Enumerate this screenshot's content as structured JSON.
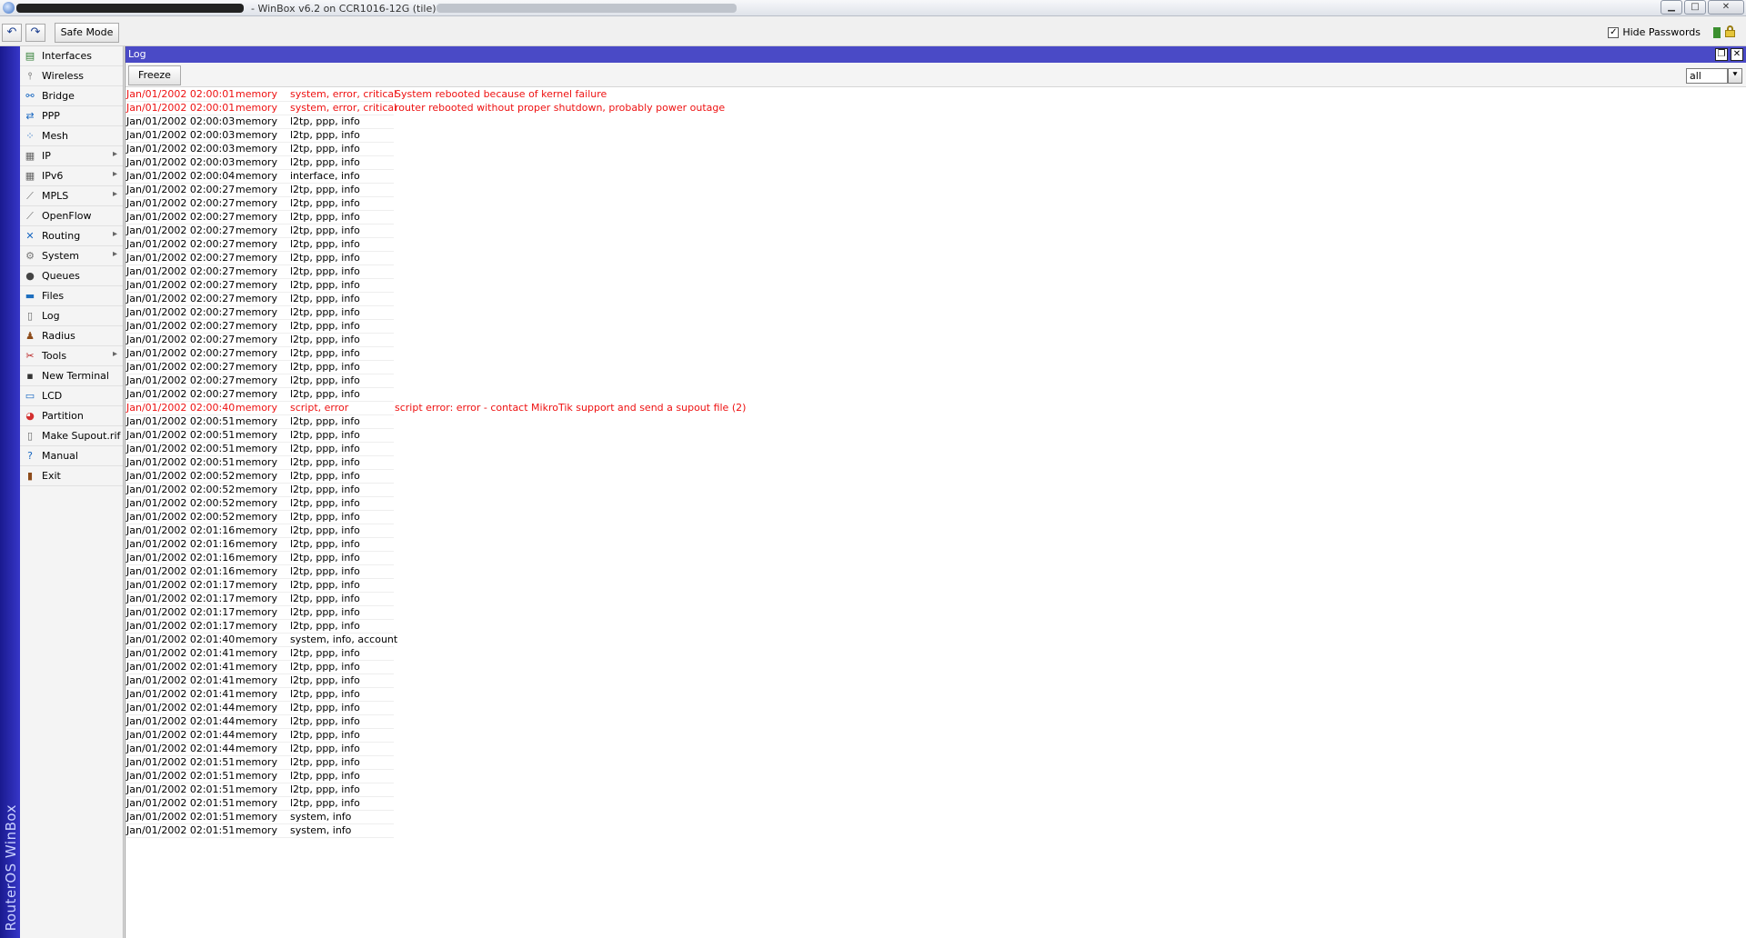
{
  "titlebar": {
    "title": " - WinBox v6.2 on CCR1016-12G (tile)"
  },
  "toolbar": {
    "undo_icon": "undo-icon",
    "redo_icon": "redo-icon",
    "safe_mode_label": "Safe Mode",
    "hide_passwords_label": "Hide Passwords",
    "hide_passwords_checked": "✓"
  },
  "brand": {
    "text": "RouterOS WinBox"
  },
  "sidebar": {
    "items": [
      {
        "label": "Interfaces",
        "icon": "interfaces-icon",
        "glyph": "▤",
        "color": "#2e7d32",
        "submenu": false
      },
      {
        "label": "Wireless",
        "icon": "wireless-icon",
        "glyph": "⫯",
        "color": "#555555",
        "submenu": false
      },
      {
        "label": "Bridge",
        "icon": "bridge-icon",
        "glyph": "⚯",
        "color": "#1565c0",
        "submenu": false
      },
      {
        "label": "PPP",
        "icon": "ppp-icon",
        "glyph": "⇄",
        "color": "#1565c0",
        "submenu": false
      },
      {
        "label": "Mesh",
        "icon": "mesh-icon",
        "glyph": "⁘",
        "color": "#1565c0",
        "submenu": false
      },
      {
        "label": "IP",
        "icon": "ip-icon",
        "glyph": "▦",
        "color": "#666666",
        "submenu": true
      },
      {
        "label": "IPv6",
        "icon": "ipv6-icon",
        "glyph": "▦",
        "color": "#666666",
        "submenu": true
      },
      {
        "label": "MPLS",
        "icon": "mpls-icon",
        "glyph": "⟋",
        "color": "#666666",
        "submenu": true
      },
      {
        "label": "OpenFlow",
        "icon": "openflow-icon",
        "glyph": "⟋",
        "color": "#666666",
        "submenu": false
      },
      {
        "label": "Routing",
        "icon": "routing-icon",
        "glyph": "✕",
        "color": "#1565c0",
        "submenu": true
      },
      {
        "label": "System",
        "icon": "system-icon",
        "glyph": "⚙",
        "color": "#777777",
        "submenu": true
      },
      {
        "label": "Queues",
        "icon": "queues-icon",
        "glyph": "●",
        "color": "#444444",
        "submenu": false
      },
      {
        "label": "Files",
        "icon": "files-icon",
        "glyph": "▬",
        "color": "#1e6fbf",
        "submenu": false
      },
      {
        "label": "Log",
        "icon": "log-icon",
        "glyph": "▯",
        "color": "#666666",
        "submenu": false
      },
      {
        "label": "Radius",
        "icon": "radius-icon",
        "glyph": "♟",
        "color": "#8d4b1a",
        "submenu": false
      },
      {
        "label": "Tools",
        "icon": "tools-icon",
        "glyph": "✂",
        "color": "#b71c1c",
        "submenu": true
      },
      {
        "label": "New Terminal",
        "icon": "terminal-icon",
        "glyph": "▪",
        "color": "#333333",
        "submenu": false
      },
      {
        "label": "LCD",
        "icon": "lcd-icon",
        "glyph": "▭",
        "color": "#1565c0",
        "submenu": false
      },
      {
        "label": "Partition",
        "icon": "partition-icon",
        "glyph": "◕",
        "color": "#d32f2f",
        "submenu": false
      },
      {
        "label": "Make Supout.rif",
        "icon": "supout-icon",
        "glyph": "▯",
        "color": "#666666",
        "submenu": false
      },
      {
        "label": "Manual",
        "icon": "manual-icon",
        "glyph": "?",
        "color": "#1565c0",
        "submenu": false
      },
      {
        "label": "Exit",
        "icon": "exit-icon",
        "glyph": "▮",
        "color": "#8d4b1a",
        "submenu": false
      }
    ]
  },
  "logwin": {
    "title": "Log",
    "restore_icon": "restore-icon",
    "close_icon": "close-icon",
    "freeze_label": "Freeze",
    "filter_value": "all",
    "filter_icon": "dropdown-icon"
  },
  "colors": {
    "error_text": "#ee1111",
    "window_title": "#4a4ac6"
  },
  "log": [
    {
      "time": "Jan/01/2002 02:00:01",
      "buffer": "memory",
      "topics": "system, error, critical",
      "message": "System rebooted because of kernel failure",
      "red": true
    },
    {
      "time": "Jan/01/2002 02:00:01",
      "buffer": "memory",
      "topics": "system, error, critical",
      "message": "router rebooted without proper shutdown, probably power outage",
      "red": true
    },
    {
      "time": "Jan/01/2002 02:00:03",
      "buffer": "memory",
      "topics": "l2tp, ppp, info",
      "message": "",
      "red": false
    },
    {
      "time": "Jan/01/2002 02:00:03",
      "buffer": "memory",
      "topics": "l2tp, ppp, info",
      "message": "",
      "red": false
    },
    {
      "time": "Jan/01/2002 02:00:03",
      "buffer": "memory",
      "topics": "l2tp, ppp, info",
      "message": "",
      "red": false
    },
    {
      "time": "Jan/01/2002 02:00:03",
      "buffer": "memory",
      "topics": "l2tp, ppp, info",
      "message": "",
      "red": false
    },
    {
      "time": "Jan/01/2002 02:00:04",
      "buffer": "memory",
      "topics": "interface, info",
      "message": "",
      "red": false
    },
    {
      "time": "Jan/01/2002 02:00:27",
      "buffer": "memory",
      "topics": "l2tp, ppp, info",
      "message": "",
      "red": false
    },
    {
      "time": "Jan/01/2002 02:00:27",
      "buffer": "memory",
      "topics": "l2tp, ppp, info",
      "message": "",
      "red": false
    },
    {
      "time": "Jan/01/2002 02:00:27",
      "buffer": "memory",
      "topics": "l2tp, ppp, info",
      "message": "",
      "red": false
    },
    {
      "time": "Jan/01/2002 02:00:27",
      "buffer": "memory",
      "topics": "l2tp, ppp, info",
      "message": "",
      "red": false
    },
    {
      "time": "Jan/01/2002 02:00:27",
      "buffer": "memory",
      "topics": "l2tp, ppp, info",
      "message": "",
      "red": false
    },
    {
      "time": "Jan/01/2002 02:00:27",
      "buffer": "memory",
      "topics": "l2tp, ppp, info",
      "message": "",
      "red": false
    },
    {
      "time": "Jan/01/2002 02:00:27",
      "buffer": "memory",
      "topics": "l2tp, ppp, info",
      "message": "",
      "red": false
    },
    {
      "time": "Jan/01/2002 02:00:27",
      "buffer": "memory",
      "topics": "l2tp, ppp, info",
      "message": "",
      "red": false
    },
    {
      "time": "Jan/01/2002 02:00:27",
      "buffer": "memory",
      "topics": "l2tp, ppp, info",
      "message": "",
      "red": false
    },
    {
      "time": "Jan/01/2002 02:00:27",
      "buffer": "memory",
      "topics": "l2tp, ppp, info",
      "message": "",
      "red": false
    },
    {
      "time": "Jan/01/2002 02:00:27",
      "buffer": "memory",
      "topics": "l2tp, ppp, info",
      "message": "",
      "red": false
    },
    {
      "time": "Jan/01/2002 02:00:27",
      "buffer": "memory",
      "topics": "l2tp, ppp, info",
      "message": "",
      "red": false
    },
    {
      "time": "Jan/01/2002 02:00:27",
      "buffer": "memory",
      "topics": "l2tp, ppp, info",
      "message": "",
      "red": false
    },
    {
      "time": "Jan/01/2002 02:00:27",
      "buffer": "memory",
      "topics": "l2tp, ppp, info",
      "message": "",
      "red": false
    },
    {
      "time": "Jan/01/2002 02:00:27",
      "buffer": "memory",
      "topics": "l2tp, ppp, info",
      "message": "",
      "red": false
    },
    {
      "time": "Jan/01/2002 02:00:27",
      "buffer": "memory",
      "topics": "l2tp, ppp, info",
      "message": "",
      "red": false
    },
    {
      "time": "Jan/01/2002 02:00:40",
      "buffer": "memory",
      "topics": "script, error",
      "message": "script error: error - contact MikroTik support and send a supout file (2)",
      "red": true
    },
    {
      "time": "Jan/01/2002 02:00:51",
      "buffer": "memory",
      "topics": "l2tp, ppp, info",
      "message": "",
      "red": false
    },
    {
      "time": "Jan/01/2002 02:00:51",
      "buffer": "memory",
      "topics": "l2tp, ppp, info",
      "message": "",
      "red": false
    },
    {
      "time": "Jan/01/2002 02:00:51",
      "buffer": "memory",
      "topics": "l2tp, ppp, info",
      "message": "",
      "red": false
    },
    {
      "time": "Jan/01/2002 02:00:51",
      "buffer": "memory",
      "topics": "l2tp, ppp, info",
      "message": "",
      "red": false
    },
    {
      "time": "Jan/01/2002 02:00:52",
      "buffer": "memory",
      "topics": "l2tp, ppp, info",
      "message": "",
      "red": false
    },
    {
      "time": "Jan/01/2002 02:00:52",
      "buffer": "memory",
      "topics": "l2tp, ppp, info",
      "message": "",
      "red": false
    },
    {
      "time": "Jan/01/2002 02:00:52",
      "buffer": "memory",
      "topics": "l2tp, ppp, info",
      "message": "",
      "red": false
    },
    {
      "time": "Jan/01/2002 02:00:52",
      "buffer": "memory",
      "topics": "l2tp, ppp, info",
      "message": "",
      "red": false
    },
    {
      "time": "Jan/01/2002 02:01:16",
      "buffer": "memory",
      "topics": "l2tp, ppp, info",
      "message": "",
      "red": false
    },
    {
      "time": "Jan/01/2002 02:01:16",
      "buffer": "memory",
      "topics": "l2tp, ppp, info",
      "message": "",
      "red": false
    },
    {
      "time": "Jan/01/2002 02:01:16",
      "buffer": "memory",
      "topics": "l2tp, ppp, info",
      "message": "",
      "red": false
    },
    {
      "time": "Jan/01/2002 02:01:16",
      "buffer": "memory",
      "topics": "l2tp, ppp, info",
      "message": "",
      "red": false
    },
    {
      "time": "Jan/01/2002 02:01:17",
      "buffer": "memory",
      "topics": "l2tp, ppp, info",
      "message": "",
      "red": false
    },
    {
      "time": "Jan/01/2002 02:01:17",
      "buffer": "memory",
      "topics": "l2tp, ppp, info",
      "message": "",
      "red": false
    },
    {
      "time": "Jan/01/2002 02:01:17",
      "buffer": "memory",
      "topics": "l2tp, ppp, info",
      "message": "",
      "red": false
    },
    {
      "time": "Jan/01/2002 02:01:17",
      "buffer": "memory",
      "topics": "l2tp, ppp, info",
      "message": "",
      "red": false
    },
    {
      "time": "Jan/01/2002 02:01:40",
      "buffer": "memory",
      "topics": "system, info, account",
      "message": "",
      "red": false
    },
    {
      "time": "Jan/01/2002 02:01:41",
      "buffer": "memory",
      "topics": "l2tp, ppp, info",
      "message": "",
      "red": false
    },
    {
      "time": "Jan/01/2002 02:01:41",
      "buffer": "memory",
      "topics": "l2tp, ppp, info",
      "message": "",
      "red": false
    },
    {
      "time": "Jan/01/2002 02:01:41",
      "buffer": "memory",
      "topics": "l2tp, ppp, info",
      "message": "",
      "red": false
    },
    {
      "time": "Jan/01/2002 02:01:41",
      "buffer": "memory",
      "topics": "l2tp, ppp, info",
      "message": "",
      "red": false
    },
    {
      "time": "Jan/01/2002 02:01:44",
      "buffer": "memory",
      "topics": "l2tp, ppp, info",
      "message": "",
      "red": false
    },
    {
      "time": "Jan/01/2002 02:01:44",
      "buffer": "memory",
      "topics": "l2tp, ppp, info",
      "message": "",
      "red": false
    },
    {
      "time": "Jan/01/2002 02:01:44",
      "buffer": "memory",
      "topics": "l2tp, ppp, info",
      "message": "",
      "red": false
    },
    {
      "time": "Jan/01/2002 02:01:44",
      "buffer": "memory",
      "topics": "l2tp, ppp, info",
      "message": "",
      "red": false
    },
    {
      "time": "Jan/01/2002 02:01:51",
      "buffer": "memory",
      "topics": "l2tp, ppp, info",
      "message": "",
      "red": false
    },
    {
      "time": "Jan/01/2002 02:01:51",
      "buffer": "memory",
      "topics": "l2tp, ppp, info",
      "message": "",
      "red": false
    },
    {
      "time": "Jan/01/2002 02:01:51",
      "buffer": "memory",
      "topics": "l2tp, ppp, info",
      "message": "",
      "red": false
    },
    {
      "time": "Jan/01/2002 02:01:51",
      "buffer": "memory",
      "topics": "l2tp, ppp, info",
      "message": "",
      "red": false
    },
    {
      "time": "Jan/01/2002 02:01:51",
      "buffer": "memory",
      "topics": "system, info",
      "message": "",
      "red": false
    },
    {
      "time": "Jan/01/2002 02:01:51",
      "buffer": "memory",
      "topics": "system, info",
      "message": "",
      "red": false
    }
  ]
}
